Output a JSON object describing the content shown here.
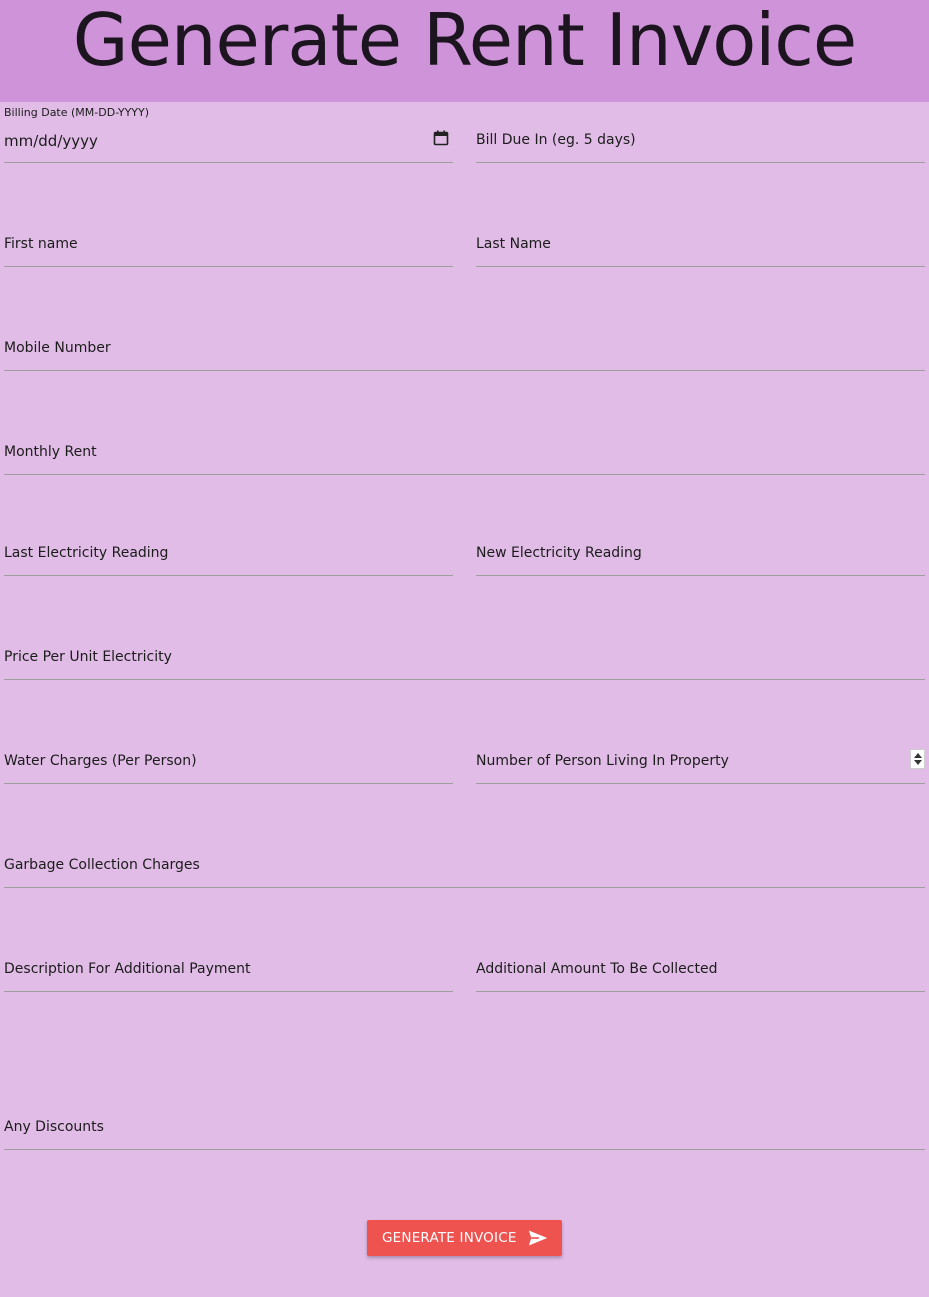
{
  "header": {
    "title": "Generate Rent Invoice"
  },
  "form": {
    "billing_date": {
      "caption": "Billing Date (MM-DD-YYYY)",
      "placeholder": "mm/dd/yyyy"
    },
    "bill_due": {
      "label": "Bill Due In (eg. 5 days)"
    },
    "first_name": {
      "label": "First name"
    },
    "last_name": {
      "label": "Last Name"
    },
    "mobile_number": {
      "label": "Mobile Number"
    },
    "monthly_rent": {
      "label": "Monthly Rent"
    },
    "last_electricity_reading": {
      "label": "Last Electricity Reading"
    },
    "new_electricity_reading": {
      "label": "New Electricity Reading"
    },
    "price_per_unit": {
      "label": "Price Per Unit Electricity"
    },
    "water_charges": {
      "label": "Water Charges (Per Person)"
    },
    "persons_living": {
      "label": "Number of Person Living In Property"
    },
    "garbage_charges": {
      "label": "Garbage Collection Charges"
    },
    "additional_description": {
      "label": "Description For Additional Payment"
    },
    "additional_amount": {
      "label": "Additional Amount To Be Collected"
    },
    "discounts": {
      "label": "Any Discounts"
    }
  },
  "actions": {
    "generate_label": "Generate Invoice"
  },
  "icons": {
    "calendar": "calendar-icon",
    "spinner": "number-spinner",
    "send": "send-icon"
  },
  "colors": {
    "header_bg": "#ce93d8",
    "page_bg": "#e0bce6",
    "button_bg": "#ef5350",
    "underline": "#9e9e9e"
  }
}
